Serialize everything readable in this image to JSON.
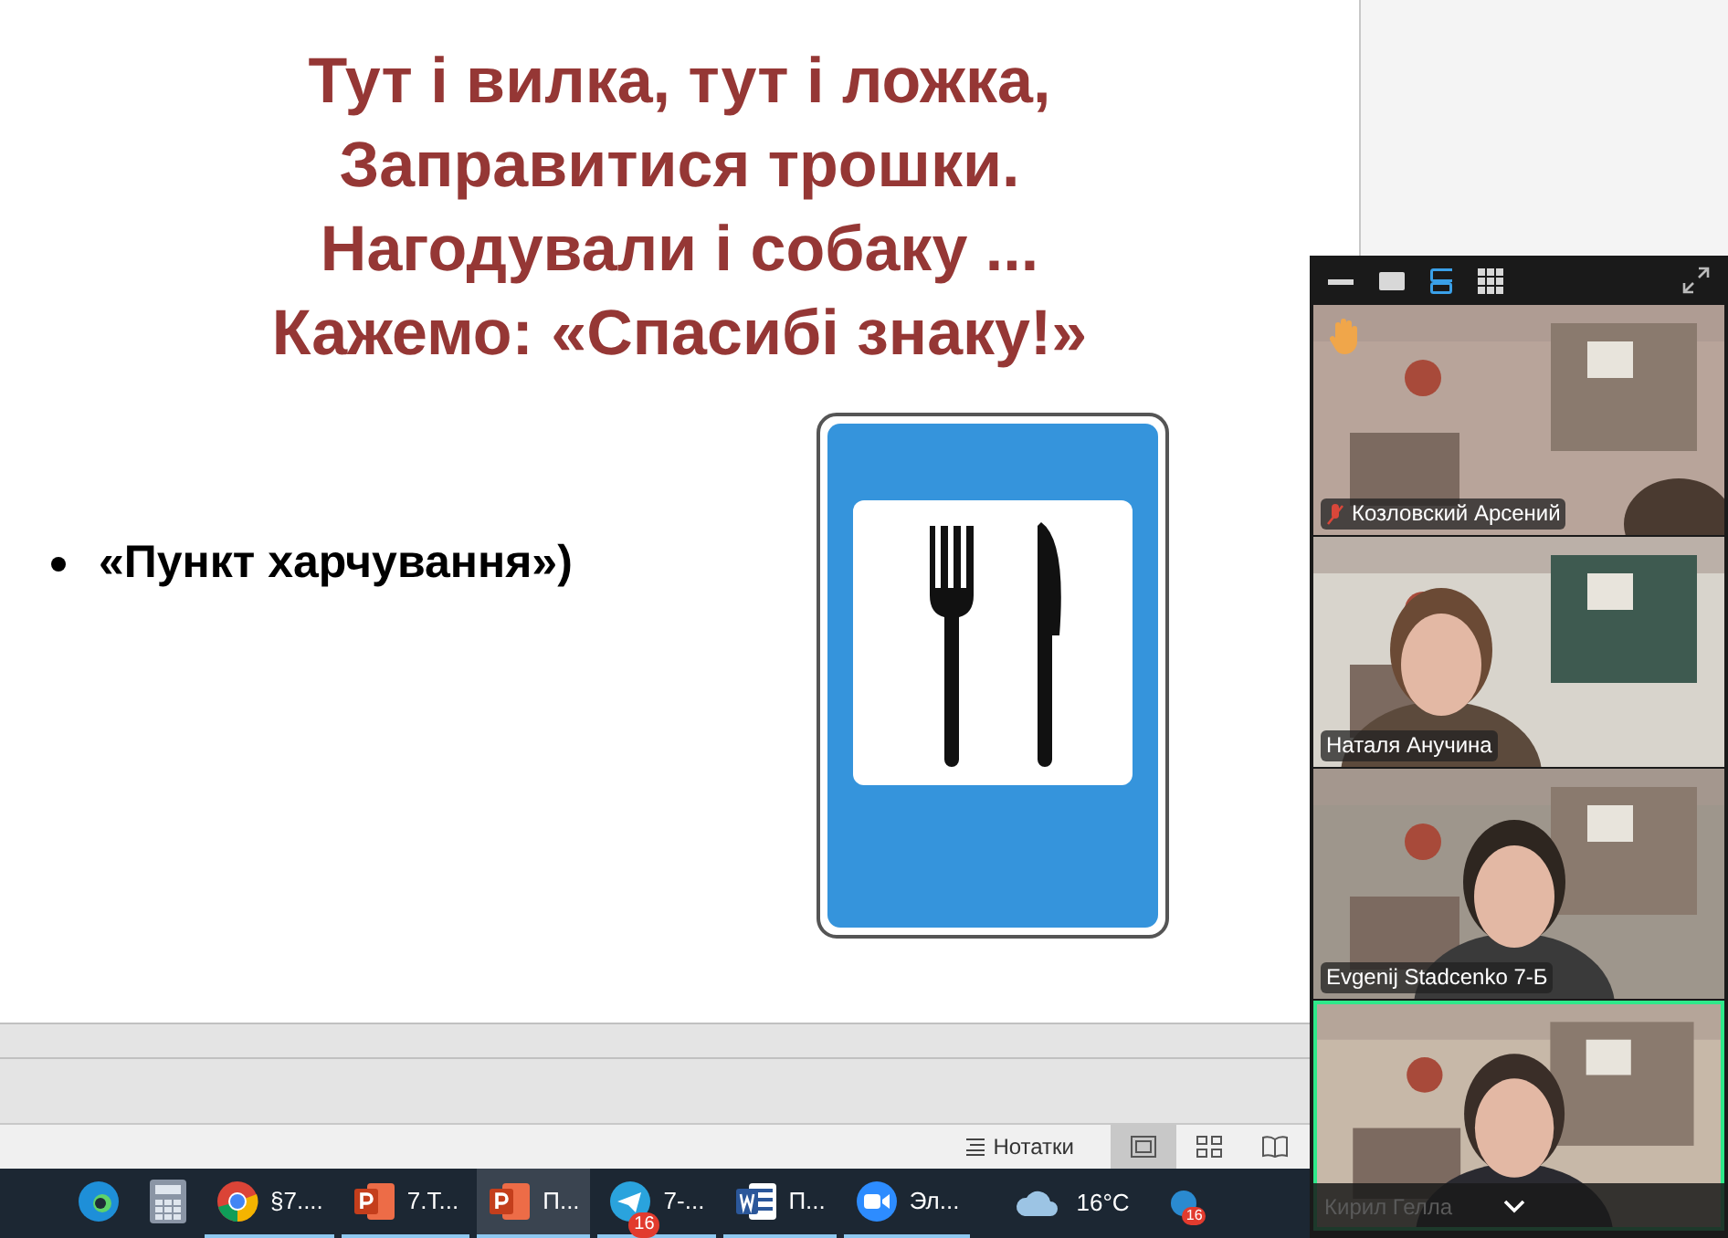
{
  "slide": {
    "title_lines": [
      "Тут і вилка, тут і ложка,",
      "Заправитися трошки.",
      "Нагодували і собаку ...",
      "Кажемо: «Спасибі знаку!»"
    ],
    "bullets": [
      "«Пункт харчування»)"
    ]
  },
  "status_bar": {
    "notes": "Нотатки",
    "views": [
      {
        "kind": "normal",
        "selected": true
      },
      {
        "kind": "sorter",
        "selected": false
      },
      {
        "kind": "reading",
        "selected": false
      }
    ]
  },
  "taskbar": {
    "apps": [
      {
        "kind": "edge",
        "selected": false
      },
      {
        "kind": "calculator",
        "selected": false
      },
      {
        "kind": "chrome",
        "label": "§7....",
        "selected": false
      },
      {
        "kind": "powerpoint",
        "label": "7.Т...",
        "selected": false
      },
      {
        "kind": "powerpoint",
        "label": "П...",
        "selected": true
      },
      {
        "kind": "telegram",
        "label": "7-...",
        "badge": "16",
        "selected": false
      },
      {
        "kind": "word",
        "label": "П...",
        "selected": false
      },
      {
        "kind": "zoom",
        "label": "Эл...",
        "selected": false
      }
    ],
    "weather": "16°C",
    "tray_badge": "16"
  },
  "meeting": {
    "views": [
      {
        "kind": "minimize",
        "selected": false
      },
      {
        "kind": "speaker",
        "selected": false
      },
      {
        "kind": "strip",
        "selected": true
      },
      {
        "kind": "gallery",
        "selected": false
      }
    ],
    "tiles": [
      {
        "name": "Козловский Арсений",
        "hand_raised": true,
        "muted": true,
        "active": false
      },
      {
        "name": "Наталя Анучина",
        "hand_raised": false,
        "muted": false,
        "active": false
      },
      {
        "name": "Evgenij Stadcenko 7-Б",
        "hand_raised": false,
        "muted": false,
        "active": false
      },
      {
        "name": "Кирил Гелла",
        "hand_raised": false,
        "muted": false,
        "active": true
      }
    ]
  }
}
